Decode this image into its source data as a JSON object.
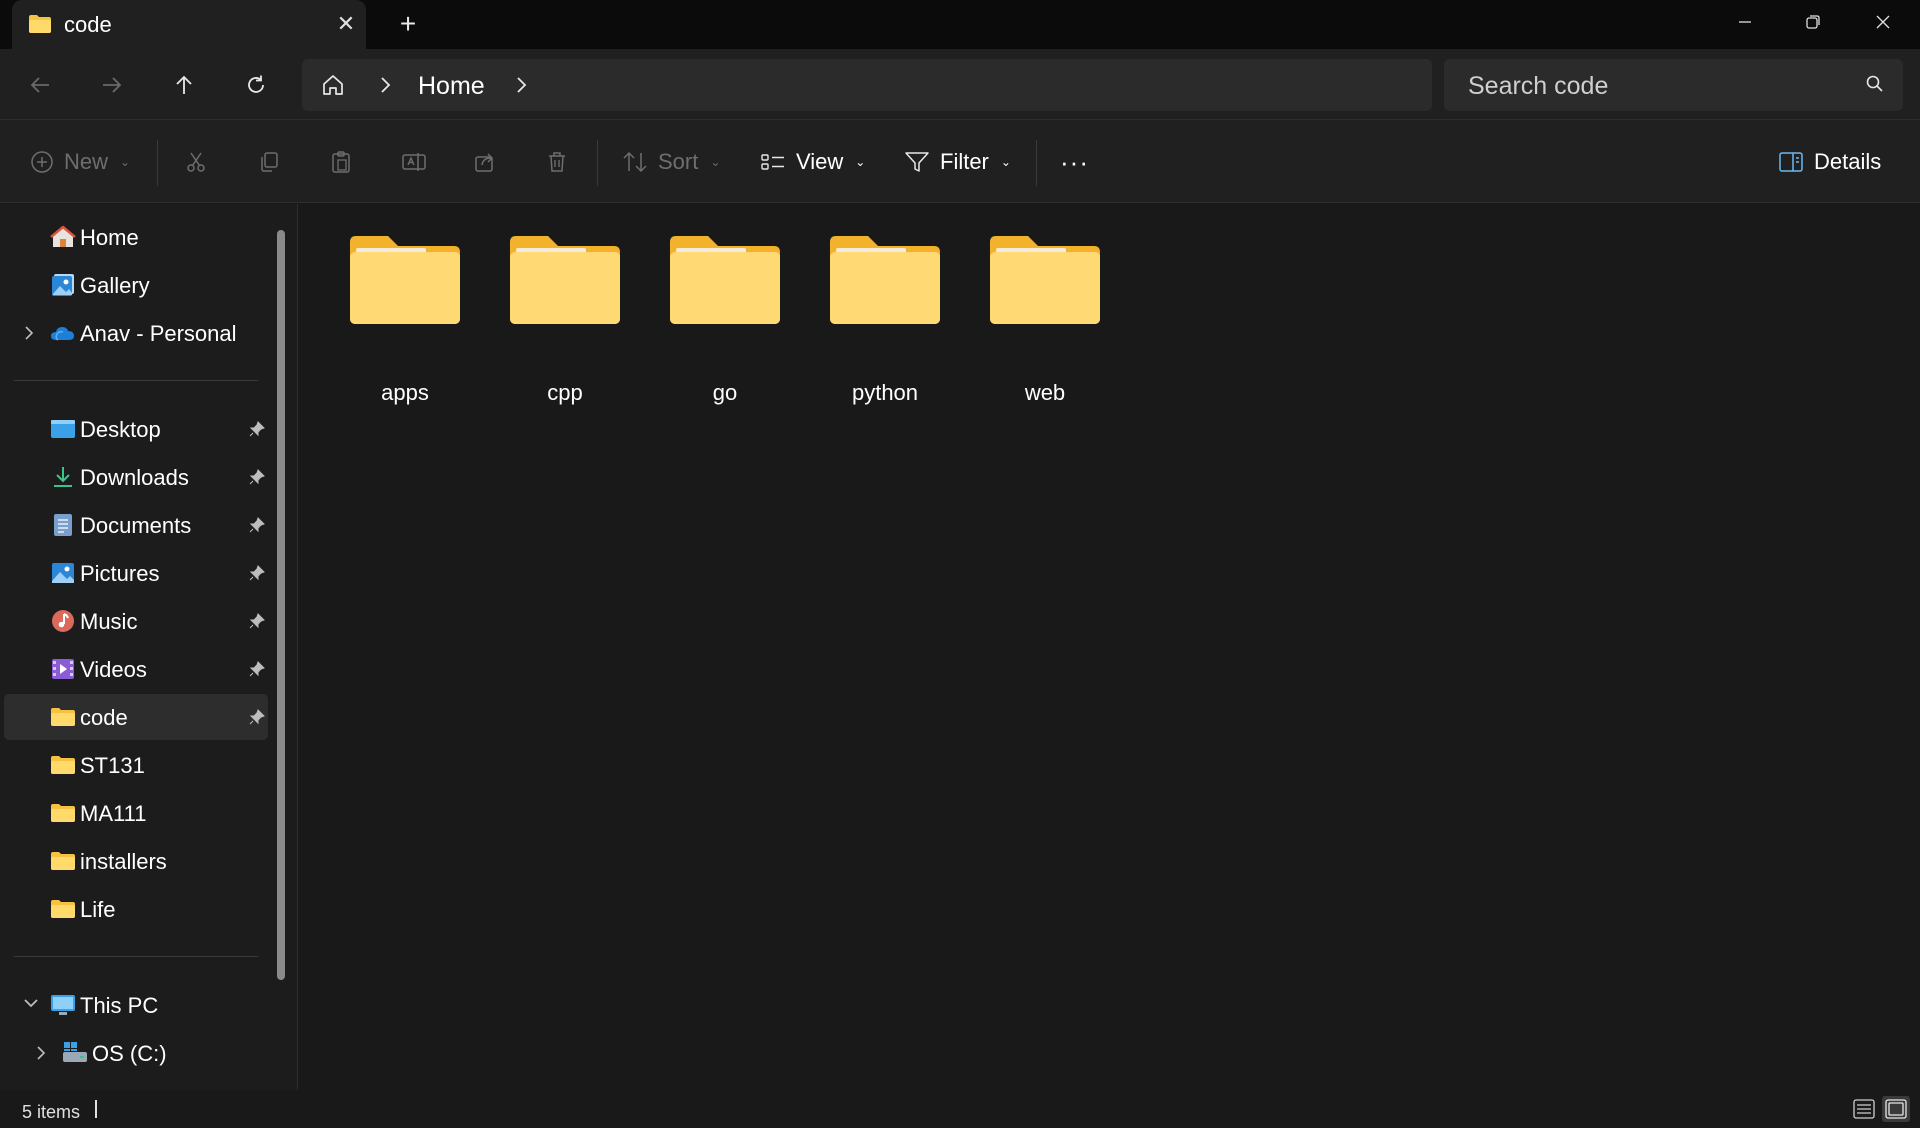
{
  "tab": {
    "title": "code",
    "close_glyph": "✕",
    "new_tab_glyph": "+"
  },
  "address": {
    "crumb": "Home"
  },
  "search": {
    "placeholder": "Search code"
  },
  "toolbar": {
    "new_label": "New",
    "sort_label": "Sort",
    "view_label": "View",
    "filter_label": "Filter",
    "more_glyph": "···",
    "details_label": "Details"
  },
  "sidebar": {
    "quick": [
      {
        "label": "Home",
        "icon": "home-icon"
      },
      {
        "label": "Gallery",
        "icon": "gallery-icon"
      },
      {
        "label": "Anav - Personal",
        "icon": "onedrive-icon"
      }
    ],
    "pinned": [
      {
        "label": "Desktop",
        "icon": "desktop-icon"
      },
      {
        "label": "Downloads",
        "icon": "download-icon"
      },
      {
        "label": "Documents",
        "icon": "documents-icon"
      },
      {
        "label": "Pictures",
        "icon": "pictures-icon"
      },
      {
        "label": "Music",
        "icon": "music-icon"
      },
      {
        "label": "Videos",
        "icon": "videos-icon"
      },
      {
        "label": "code",
        "icon": "folder-icon"
      },
      {
        "label": "ST131",
        "icon": "folder-icon"
      },
      {
        "label": "MA111",
        "icon": "folder-icon"
      },
      {
        "label": "installers",
        "icon": "folder-icon"
      },
      {
        "label": "Life",
        "icon": "folder-icon"
      }
    ],
    "pc": [
      {
        "label": "This PC",
        "icon": "pc-icon"
      },
      {
        "label": "OS (C:)",
        "icon": "drive-icon"
      }
    ]
  },
  "folders": [
    "apps",
    "cpp",
    "go",
    "python",
    "web"
  ],
  "status": {
    "item_count": "5 items"
  },
  "colors": {
    "folder_top": "#f5c242",
    "folder_front": "#ffd96a",
    "background": "#191919"
  }
}
